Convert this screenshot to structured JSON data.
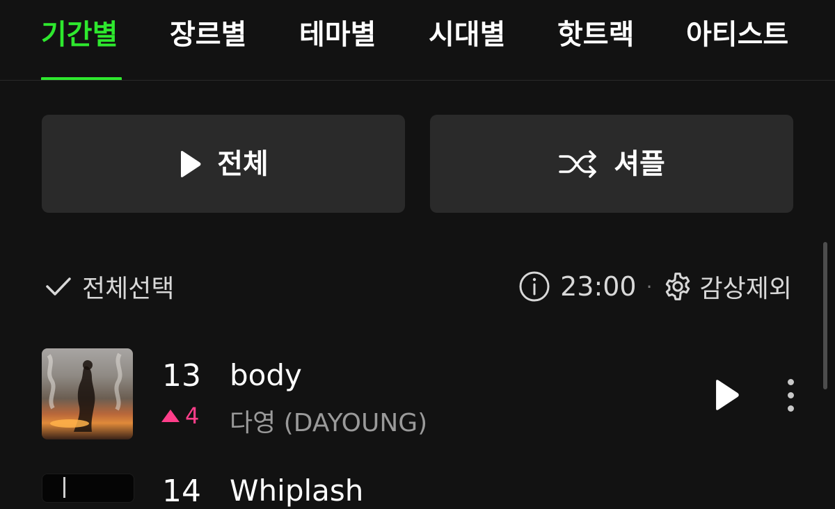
{
  "tabs": [
    {
      "label": "기간별",
      "active": true
    },
    {
      "label": "장르별",
      "active": false
    },
    {
      "label": "테마별",
      "active": false
    },
    {
      "label": "시대별",
      "active": false
    },
    {
      "label": "핫트랙",
      "active": false
    },
    {
      "label": "아티스트",
      "active": false
    }
  ],
  "actions": {
    "play_all_label": "전체",
    "shuffle_label": "셔플"
  },
  "list_controls": {
    "select_all_label": "전체선택",
    "update_time": "23:00",
    "separator": "·",
    "exclude_label": "감상제외"
  },
  "tracks": [
    {
      "rank": "13",
      "change": "4",
      "change_direction": "up",
      "title": "body",
      "artist": "다영 (DAYOUNG)"
    },
    {
      "rank": "14",
      "title": "Whiplash"
    }
  ],
  "colors": {
    "accent": "#2ee82e",
    "rank_up": "#ff3e8a",
    "background": "#121212",
    "button_bg": "#2a2a2a"
  },
  "icons": [
    "play-icon",
    "shuffle-icon",
    "check-icon",
    "info-icon",
    "gear-icon",
    "more-vertical-icon"
  ]
}
